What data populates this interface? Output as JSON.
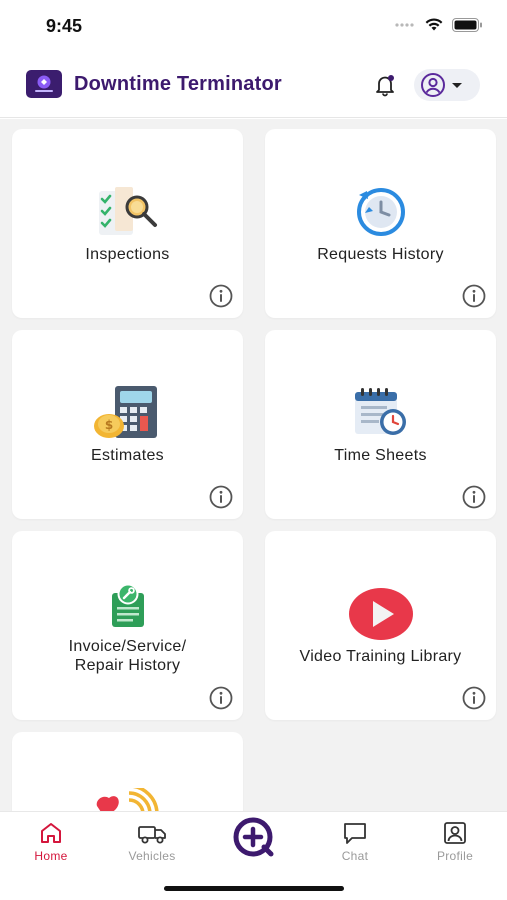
{
  "status_bar": {
    "time": "9:45"
  },
  "header": {
    "title": "Downtime Terminator",
    "logo_icon": "app-logo",
    "notification_icon": "bell-icon",
    "profile_icon": "user-circle-icon",
    "dropdown_icon": "caret-down-icon"
  },
  "tiles": [
    {
      "label": "Inspections",
      "icon": "inspection-checklist-icon"
    },
    {
      "label": "Requests History",
      "icon": "history-clock-icon"
    },
    {
      "label": "Estimates",
      "icon": "calculator-icon"
    },
    {
      "label": "Time Sheets",
      "icon": "timesheet-calendar-icon"
    },
    {
      "label": "Invoice/Service/\nRepair History",
      "icon": "invoice-clipboard-icon"
    },
    {
      "label": "Video Training Library",
      "icon": "play-video-icon"
    },
    {
      "label": "",
      "icon": "signal-icon"
    }
  ],
  "info_icon": "info-icon",
  "bottom_nav": {
    "items": [
      {
        "label": "Home",
        "icon": "home-icon",
        "active": true
      },
      {
        "label": "Vehicles",
        "icon": "truck-icon",
        "active": false
      },
      {
        "label": "",
        "icon": "add-circle-icon",
        "active": false
      },
      {
        "label": "Chat",
        "icon": "chat-icon",
        "active": false
      },
      {
        "label": "Profile",
        "icon": "profile-icon",
        "active": false
      }
    ]
  },
  "colors": {
    "brand": "#3d1a6e",
    "active": "#d4163c",
    "inactive": "#9a9a9a",
    "background": "#f2f2f2"
  }
}
